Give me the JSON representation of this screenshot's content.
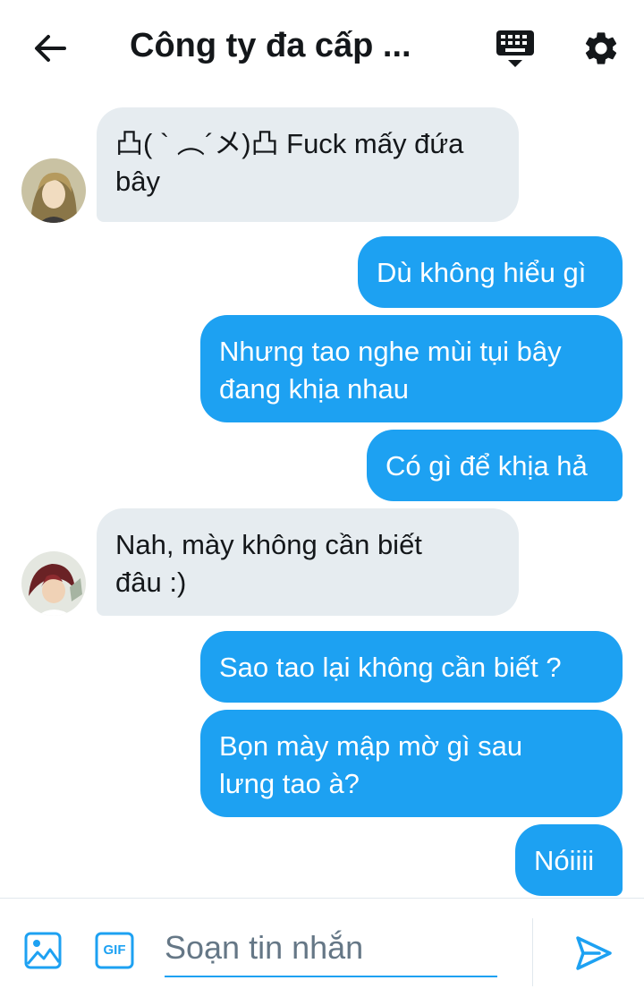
{
  "header": {
    "title": "Công ty đa cấp ...",
    "icons": {
      "back": "back-arrow-icon",
      "keyboard": "keyboard-icon",
      "settings": "gear-icon"
    }
  },
  "messages": [
    {
      "side": "incoming",
      "lines": [
        "凸( ` ︵´メ)凸 Fuck mấy đứa",
        "bây"
      ]
    },
    {
      "side": "outgoing",
      "lines": [
        "Dù không hiểu gì"
      ]
    },
    {
      "side": "outgoing",
      "lines": [
        "Nhưng tao nghe mùi tụi bây",
        "đang khịa nhau"
      ]
    },
    {
      "side": "outgoing",
      "lines": [
        "Có gì để khịa hả"
      ]
    },
    {
      "side": "incoming",
      "lines": [
        "Nah, mày không cần biết",
        "đâu :)"
      ]
    },
    {
      "side": "outgoing",
      "lines": [
        "Sao tao lại không cần biết ?"
      ]
    },
    {
      "side": "outgoing",
      "lines": [
        "Bọn mày mập mờ gì sau",
        "lưng tao à?"
      ]
    },
    {
      "side": "outgoing",
      "lines": [
        "Nóiiii"
      ]
    }
  ],
  "composer": {
    "placeholder": "Soạn tin nhắn",
    "gif_label": "GIF",
    "icons": {
      "image": "image-icon",
      "gif": "gif-icon",
      "send": "send-icon"
    }
  },
  "colors": {
    "accent": "#1da1f2",
    "incoming_bubble": "#e6ecf0",
    "text": "#14171a",
    "placeholder": "#657786"
  }
}
